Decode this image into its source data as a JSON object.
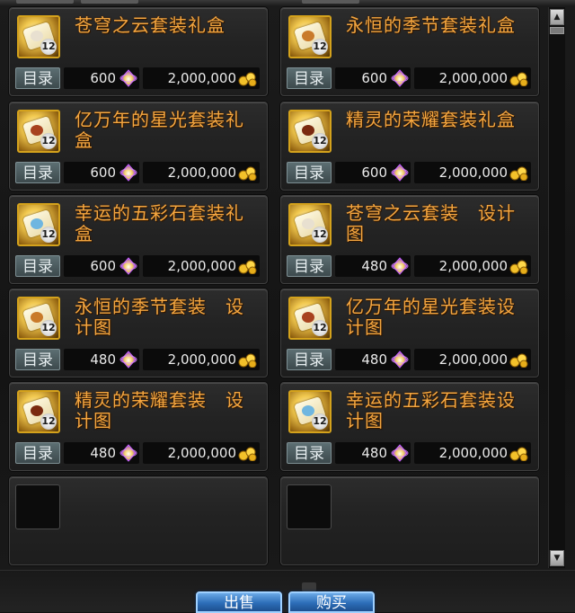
{
  "shop": {
    "items": [
      {
        "name": "苍穹之云套装礼盒",
        "catalog": "目录",
        "price_gem": "600",
        "price_gold": "2,000,000",
        "badge": "12",
        "icon": "gift-box-icon",
        "accent": "#e8e0d0"
      },
      {
        "name": "永恒的季节套装礼盒",
        "catalog": "目录",
        "price_gem": "600",
        "price_gold": "2,000,000",
        "badge": "12",
        "icon": "gift-box-icon",
        "accent": "#c97a2a"
      },
      {
        "name": "亿万年的星光套装礼盒",
        "catalog": "目录",
        "price_gem": "600",
        "price_gold": "2,000,000",
        "badge": "12",
        "icon": "gift-box-icon",
        "accent": "#a8421f"
      },
      {
        "name": "精灵的荣耀套装礼盒",
        "catalog": "目录",
        "price_gem": "600",
        "price_gold": "2,000,000",
        "badge": "12",
        "icon": "gift-box-icon",
        "accent": "#7a2a10"
      },
      {
        "name": "幸运的五彩石套装礼盒",
        "catalog": "目录",
        "price_gem": "600",
        "price_gold": "2,000,000",
        "badge": "12",
        "icon": "gift-box-icon",
        "accent": "#6fb6e0"
      },
      {
        "name": "苍穹之云套装　设计图",
        "catalog": "目录",
        "price_gem": "480",
        "price_gold": "2,000,000",
        "badge": "12",
        "icon": "design-scroll-icon",
        "accent": "#e8e0d0"
      },
      {
        "name": "永恒的季节套装　设计图",
        "catalog": "目录",
        "price_gem": "480",
        "price_gold": "2,000,000",
        "badge": "12",
        "icon": "design-scroll-icon",
        "accent": "#c97a2a"
      },
      {
        "name": "亿万年的星光套装设计图",
        "catalog": "目录",
        "price_gem": "480",
        "price_gold": "2,000,000",
        "badge": "12",
        "icon": "design-scroll-icon",
        "accent": "#a8421f"
      },
      {
        "name": "精灵的荣耀套装　设计图",
        "catalog": "目录",
        "price_gem": "480",
        "price_gold": "2,000,000",
        "badge": "12",
        "icon": "design-scroll-icon",
        "accent": "#7a2a10"
      },
      {
        "name": "幸运的五彩石套装设计图",
        "catalog": "目录",
        "price_gem": "480",
        "price_gold": "2,000,000",
        "badge": "12",
        "icon": "design-scroll-icon",
        "accent": "#6fb6e0"
      }
    ],
    "empty_slots": 2
  },
  "buttons": {
    "sell_label": "出售",
    "buy_label": "购买"
  },
  "colors": {
    "item_name": "#f4a640",
    "button_blue": "#2c6db8",
    "gem": "#c35cff",
    "gold": "#f3c12a"
  }
}
